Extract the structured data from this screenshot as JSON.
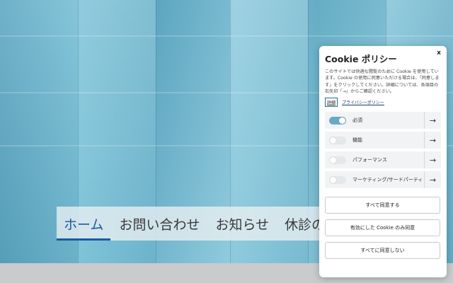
{
  "nav": {
    "items": [
      "ホーム",
      "お問い合わせ",
      "お知らせ",
      "休診の"
    ]
  },
  "cookie": {
    "title": "Cookie ポリシー",
    "close_label": "x",
    "description": "このサイトでは快適な閲覧のために Cookie を使用しています。Cookie の使用に同意いただける場合は、「同意します」をクリックしてください。詳細については、各項目の右矢印「→」からご確認ください。",
    "details_link": "詳細",
    "privacy_link": "プライバシーポリシー",
    "categories": [
      {
        "label": "必須",
        "enabled": true,
        "arrow": "→"
      },
      {
        "label": "機能",
        "enabled": false,
        "arrow": "→"
      },
      {
        "label": "パフォーマンス",
        "enabled": false,
        "arrow": "→"
      },
      {
        "label": "マーケティング/サードパーティ",
        "enabled": false,
        "arrow": "→"
      }
    ],
    "buttons": {
      "accept_all": "すべて同意する",
      "accept_selected": "有効にした Cookie のみ同意",
      "reject_all": "すべてに同意しない"
    }
  },
  "colors": {
    "accent": "#1c5aa0",
    "toggle_on": "#6aa9c6"
  }
}
